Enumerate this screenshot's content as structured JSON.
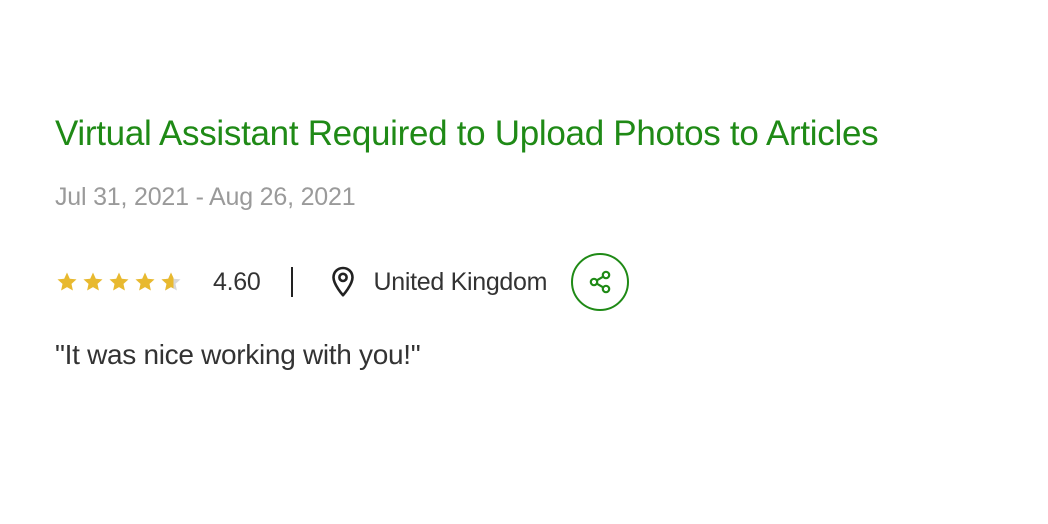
{
  "job": {
    "title": "Virtual Assistant Required to Upload Photos to Articles",
    "date_range": "Jul 31, 2021 - Aug 26, 2021",
    "rating": {
      "value": "4.60",
      "stars_filled_fraction": 0.92,
      "max_stars": 5
    },
    "location": "United Kingdom",
    "feedback": "\"It was nice working with you!\""
  },
  "icons": {
    "rating": "star-icon",
    "location": "map-pin-icon",
    "share": "share-icon"
  },
  "colors": {
    "accent": "#1f8a16",
    "star": "#e8b92f",
    "star_empty": "#d8d8d8",
    "muted_text": "#9a9a9a",
    "body_text": "#333333"
  }
}
